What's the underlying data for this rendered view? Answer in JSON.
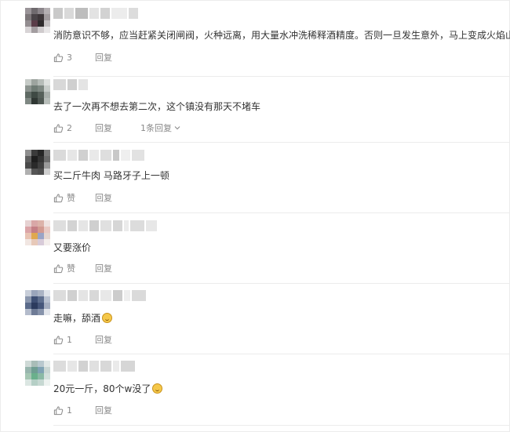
{
  "colors": {
    "text": "#333333",
    "meta": "#8a8a8a",
    "divider": "#ececec"
  },
  "icons": {
    "like": "thumbs-up-icon",
    "expand": "chevron-down-icon",
    "emoji": "grin-emoji-icon"
  },
  "comments": [
    {
      "text": "消防意识不够，应当赶紧关闭闸阀，火种远离，用大量水冲洗稀释酒精度。否则一旦发生意外，马上变成火焰山。",
      "likes": "3",
      "reply": "回复",
      "replies": ""
    },
    {
      "text": "去了一次再不想去第二次，这个镇没有那天不堵车",
      "likes": "2",
      "reply": "回复",
      "replies": "1条回复"
    },
    {
      "text": "买二斤牛肉 马路牙子上一顿",
      "likes": "赞",
      "reply": "回复",
      "replies": ""
    },
    {
      "text": "又要涨价",
      "likes": "赞",
      "reply": "回复",
      "replies": ""
    },
    {
      "text": "走嘛，舔酒",
      "likes": "1",
      "reply": "回复",
      "replies": ""
    },
    {
      "text": "20元一斤，80个w没了",
      "likes": "1",
      "reply": "回复",
      "replies": ""
    }
  ]
}
